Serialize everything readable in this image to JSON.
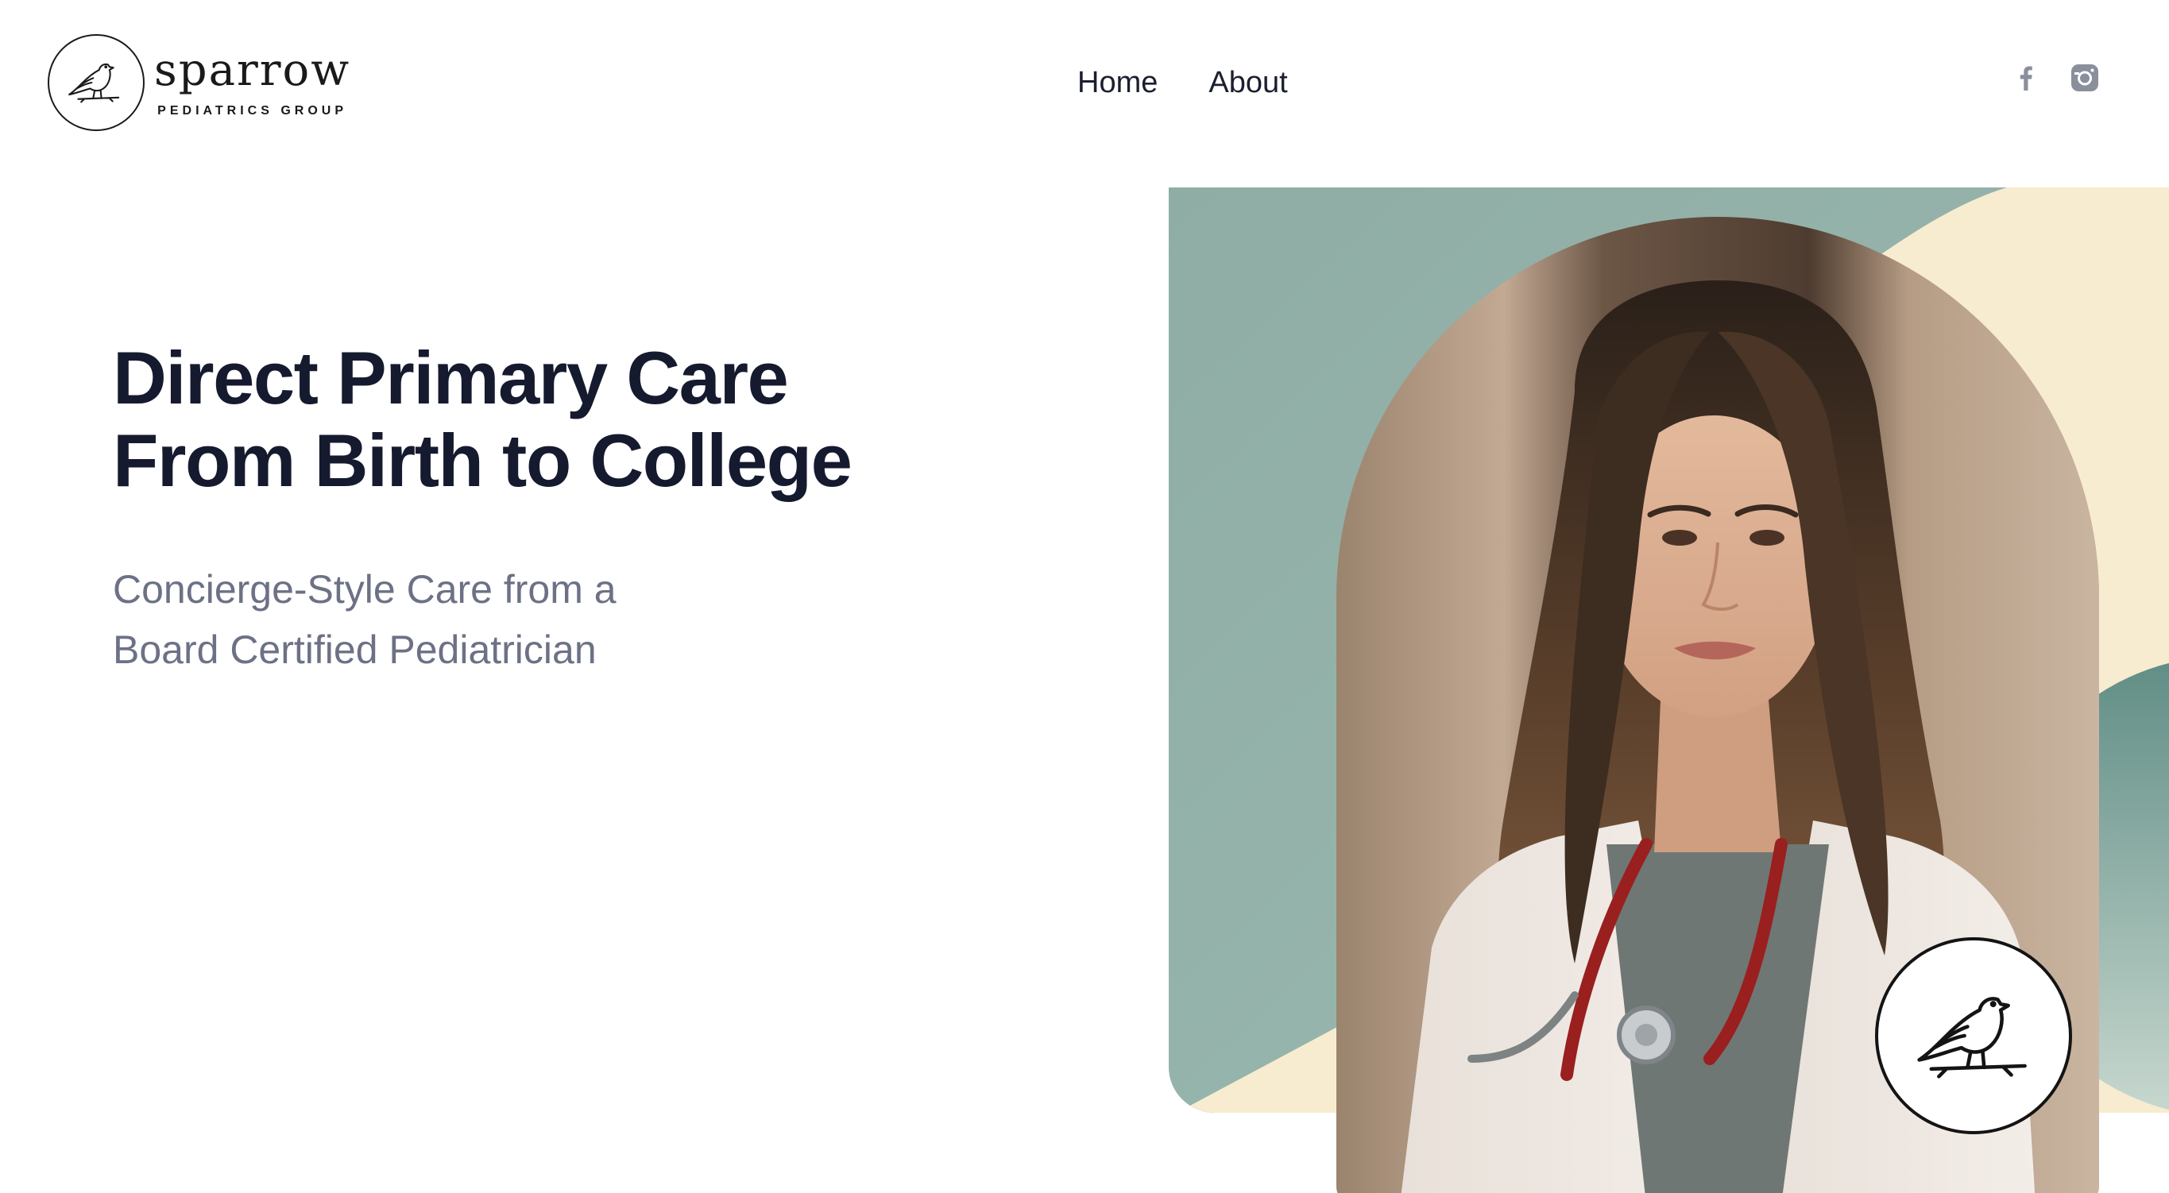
{
  "brand": {
    "name": "sparrow",
    "tagline": "PEDIATRICS GROUP",
    "logo_icon": "sparrow-bird-icon"
  },
  "nav": {
    "items": [
      {
        "label": "Home"
      },
      {
        "label": "About"
      }
    ]
  },
  "social": {
    "facebook_icon": "facebook-icon",
    "instagram_icon": "instagram-icon",
    "icon_color": "#8a8f9c"
  },
  "hero": {
    "title_line1": "Direct Primary Care",
    "title_line2": "From Birth to College",
    "subtitle_line1": "Concierge-Style Care from a",
    "subtitle_line2": "Board Certified Pediatrician"
  },
  "colors": {
    "title": "#151a2f",
    "subtitle": "#6c7186",
    "sage": "#91b0a8",
    "cream": "#f7ecd0"
  }
}
